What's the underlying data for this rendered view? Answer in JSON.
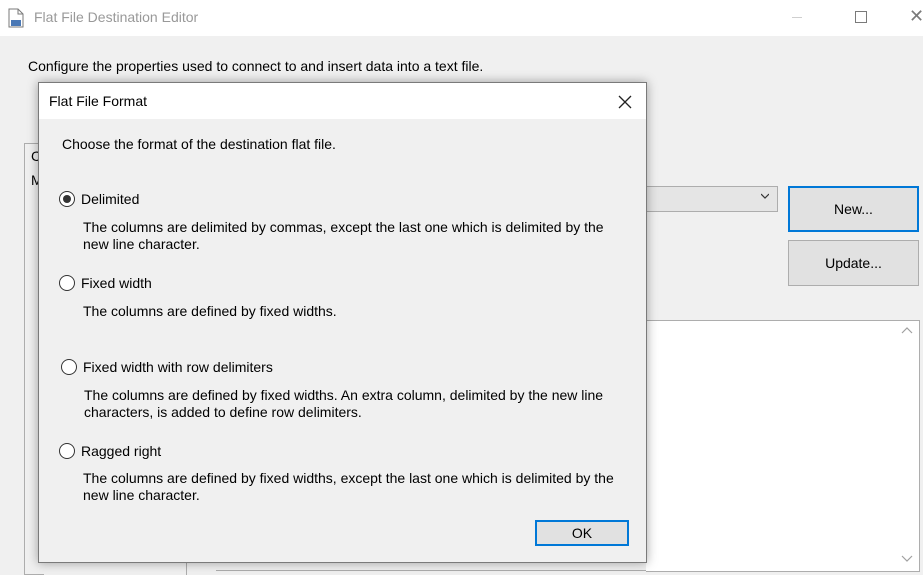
{
  "main_window": {
    "title": "Flat File Destination Editor",
    "description": "Configure the properties used to connect to and insert data into a text file.",
    "panel_letters": [
      "C",
      "M"
    ],
    "new_button": "New...",
    "update_button": "Update..."
  },
  "dialog": {
    "title": "Flat File Format",
    "prompt": "Choose the format of the destination flat file.",
    "options": [
      {
        "label": "Delimited",
        "checked": true,
        "description": "The columns are delimited by commas, except the last one which is delimited by the new line character."
      },
      {
        "label": "Fixed width",
        "checked": false,
        "description": "The columns are defined by fixed widths."
      },
      {
        "label": "Fixed width with row delimiters",
        "checked": false,
        "description": "The columns are defined by fixed widths. An extra column, delimited by the new line characters, is added to define row delimiters."
      },
      {
        "label": "Ragged right",
        "checked": false,
        "description": "The columns are defined by fixed widths, except the last one which is delimited by the new line character."
      }
    ],
    "ok_button": "OK"
  },
  "colors": {
    "accent": "#0078d7",
    "window_bg": "#f0f0f0",
    "titlebar_bg": "#ffffff",
    "button_bg": "#e1e1e1"
  }
}
